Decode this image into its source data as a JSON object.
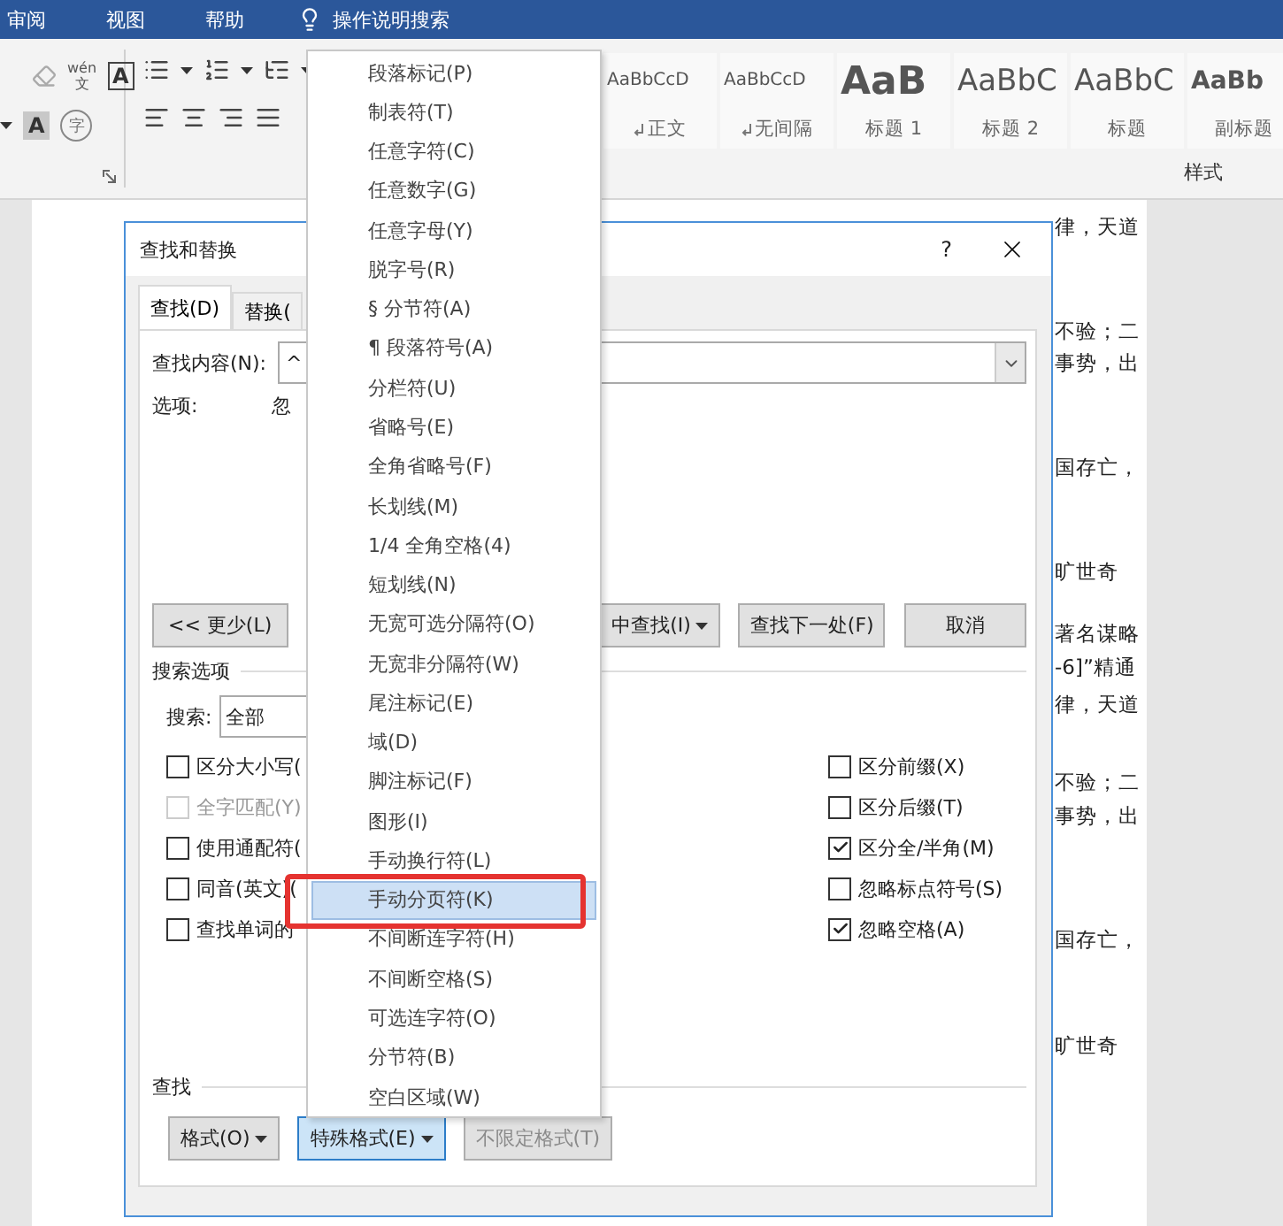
{
  "ribbon_tabs": [
    {
      "label": "审阅"
    },
    {
      "label": "视图"
    },
    {
      "label": "帮助"
    }
  ],
  "tell_me": {
    "placeholder": "操作说明搜索"
  },
  "font_group": {
    "phonetic_top": "wén",
    "phonetic_bottom": "文",
    "border_char": "A",
    "shade_char": "A",
    "enclose_char": "字"
  },
  "styles": {
    "label": "样式",
    "items": [
      {
        "preview": "AaBbCcD",
        "name": "正文",
        "kind": "body"
      },
      {
        "preview": "AaBbCcD",
        "name": "无间隔",
        "kind": "body"
      },
      {
        "preview": "AaB",
        "name": "标题 1",
        "kind": "heading1"
      },
      {
        "preview": "AaBbC",
        "name": "标题 2",
        "kind": "heading2"
      },
      {
        "preview": "AaBbC",
        "name": "标题",
        "kind": "title"
      },
      {
        "preview": "AaBb",
        "name": "副标题",
        "kind": "subtitle"
      }
    ]
  },
  "document_lines": [
    "律，天道",
    "不验；二",
    "事势，出",
    "国存亡，",
    "旷世奇",
    "著名谋略",
    "-6]”精通",
    "律，天道",
    "不验；二",
    "事势，出",
    "国存亡，",
    "旷世奇"
  ],
  "dialog": {
    "title": "查找和替换",
    "help": "?",
    "tabs": [
      {
        "label": "查找(D)",
        "selected": true
      },
      {
        "label": "替换(",
        "selected": false
      }
    ],
    "find_label": "查找内容(N):",
    "find_value": "^",
    "options_label": "选项:",
    "options_value": "忽",
    "buttons": [
      {
        "label": "<< 更少(L)",
        "dropdown": false,
        "pressed": false,
        "disabled": false
      },
      {
        "label": "中查找(I)",
        "dropdown": true,
        "pressed": false,
        "disabled": false
      },
      {
        "label": "查找下一处(F)",
        "dropdown": false,
        "pressed": false,
        "disabled": false
      },
      {
        "label": "取消",
        "dropdown": false,
        "pressed": false,
        "disabled": false
      }
    ],
    "search_options_heading": "搜索选项",
    "search_label": "搜索:",
    "search_value": "全部",
    "left_checks": [
      {
        "label": "区分大小写(",
        "checked": false,
        "disabled": false
      },
      {
        "label": "全字匹配(Y)",
        "checked": false,
        "disabled": true
      },
      {
        "label": "使用通配符(",
        "checked": false,
        "disabled": false
      },
      {
        "label": "同音(英文)(",
        "checked": false,
        "disabled": false
      },
      {
        "label": "查找单词的",
        "checked": false,
        "disabled": false
      }
    ],
    "right_checks": [
      {
        "label": "区分前缀(X)",
        "checked": false,
        "disabled": false
      },
      {
        "label": "区分后缀(T)",
        "checked": false,
        "disabled": false
      },
      {
        "label": "区分全/半角(M)",
        "checked": true,
        "disabled": false
      },
      {
        "label": "忽略标点符号(S)",
        "checked": false,
        "disabled": false
      },
      {
        "label": "忽略空格(A)",
        "checked": true,
        "disabled": false
      }
    ],
    "find_heading": "查找",
    "bottom_buttons": [
      {
        "label": "格式(O)",
        "dropdown": true,
        "pressed": false,
        "disabled": false
      },
      {
        "label": "特殊格式(E)",
        "dropdown": true,
        "pressed": true,
        "disabled": false
      },
      {
        "label": "不限定格式(T)",
        "dropdown": false,
        "pressed": false,
        "disabled": true
      }
    ]
  },
  "special_menu": {
    "items": [
      {
        "label": "段落标记(P)",
        "selected": false
      },
      {
        "label": "制表符(T)",
        "selected": false
      },
      {
        "label": "任意字符(C)",
        "selected": false
      },
      {
        "label": "任意数字(G)",
        "selected": false
      },
      {
        "label": "任意字母(Y)",
        "selected": false
      },
      {
        "label": "脱字号(R)",
        "selected": false
      },
      {
        "label": "§ 分节符(A)",
        "selected": false
      },
      {
        "label": "¶ 段落符号(A)",
        "selected": false
      },
      {
        "label": "分栏符(U)",
        "selected": false
      },
      {
        "label": "省略号(E)",
        "selected": false
      },
      {
        "label": "全角省略号(F)",
        "selected": false
      },
      {
        "label": "长划线(M)",
        "selected": false
      },
      {
        "label": "1/4 全角空格(4)",
        "selected": false
      },
      {
        "label": "短划线(N)",
        "selected": false
      },
      {
        "label": "无宽可选分隔符(O)",
        "selected": false
      },
      {
        "label": "无宽非分隔符(W)",
        "selected": false
      },
      {
        "label": "尾注标记(E)",
        "selected": false
      },
      {
        "label": "域(D)",
        "selected": false
      },
      {
        "label": "脚注标记(F)",
        "selected": false
      },
      {
        "label": "图形(I)",
        "selected": false
      },
      {
        "label": "手动换行符(L)",
        "selected": false
      },
      {
        "label": "手动分页符(K)",
        "selected": true
      },
      {
        "label": "不间断连字符(H)",
        "selected": false
      },
      {
        "label": "不间断空格(S)",
        "selected": false
      },
      {
        "label": "可选连字符(O)",
        "selected": false
      },
      {
        "label": "分节符(B)",
        "selected": false
      },
      {
        "label": "空白区域(W)",
        "selected": false
      }
    ]
  }
}
